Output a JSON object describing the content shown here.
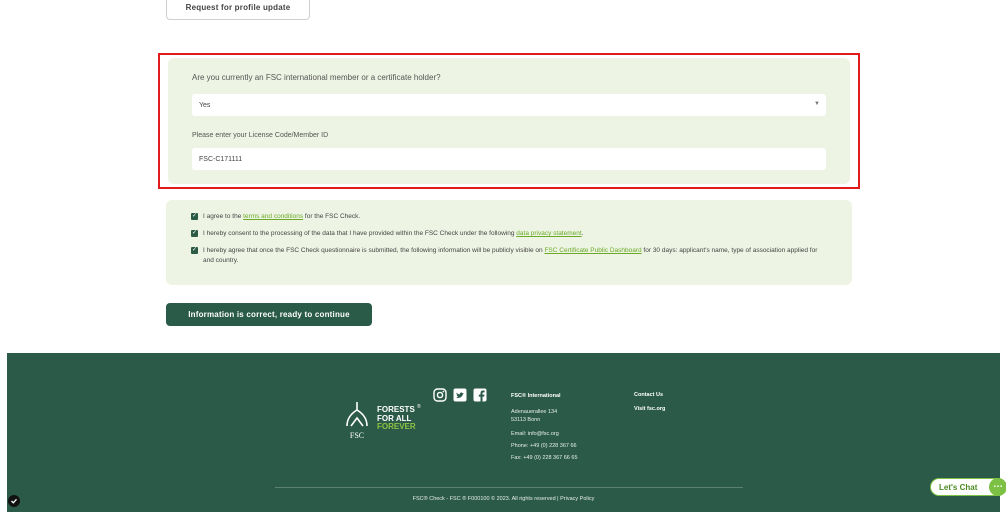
{
  "top": {
    "profile_button": "Request for profile update"
  },
  "membership": {
    "question": "Are you currently an FSC international member or a certificate holder?",
    "answer": "Yes",
    "license_label": "Please enter your License Code/Member ID",
    "license_value": "FSC-C171111"
  },
  "consent": {
    "c1_pre": "I agree to the ",
    "c1_link": "terms and conditions",
    "c1_post": " for the FSC Check.",
    "c2_pre": "I hereby consent to the processing of the data that I have provided within the FSC Check under the following ",
    "c2_link": "data privacy statement",
    "c2_post": ".",
    "c3_pre": "I hereby agree that once the FSC Check questionnaire is submitted, the following information will be publicly visible on ",
    "c3_link": "FSC Certificate Public Dashboard",
    "c3_post": " for 30 days: applicant's name, type of association applied for and country."
  },
  "cta": {
    "label": "Information is correct, ready to continue"
  },
  "footer": {
    "logo": {
      "fsc": "FSC",
      "line1": "FORESTS",
      "line2": "FOR ALL",
      "line3": "FOREVER",
      "reg": "®"
    },
    "social_icons": [
      "instagram-icon",
      "twitter-icon",
      "facebook-icon"
    ],
    "org": {
      "heading": "FSC® International",
      "address1": "Adenauerallee 134",
      "address2": "53113 Bonn",
      "email": "Email: info@fsc.org",
      "phone": "Phone: +49 (0) 228 367 66",
      "fax": "Fax: +49 (0) 228 367 66 65"
    },
    "contact": {
      "heading": "Contact Us",
      "visit": "Visit fsc.org"
    },
    "copyright": "FSC® Check - FSC ® F000100 © 2023. All rights reserved | Privacy Policy"
  },
  "chat": {
    "label": "Let's Chat"
  },
  "colors": {
    "brand_green": "#2b5a49",
    "accent_green": "#7cc143",
    "highlight_red": "#e01b1b",
    "panel_bg": "#eef4e4"
  }
}
